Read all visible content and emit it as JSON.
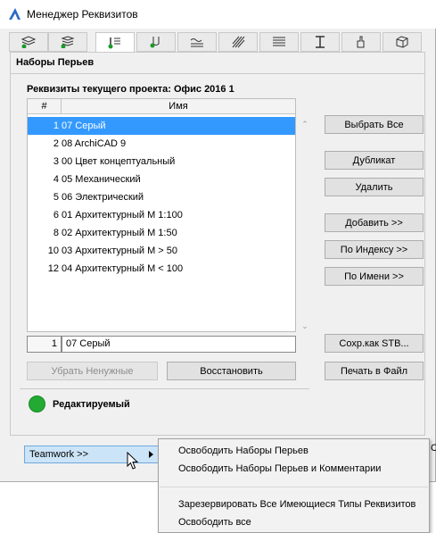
{
  "window": {
    "title": "Менеджер Реквизитов",
    "panel_title": "Наборы Перьев",
    "section_label": "Реквизиты текущего проекта: Офис 2016 1"
  },
  "tabs": [
    {
      "icon": "layers-icon",
      "active": false
    },
    {
      "icon": "layer-combinations-icon",
      "active": false
    },
    {
      "icon": "pen-sets-icon",
      "active": true
    },
    {
      "icon": "pen-icon",
      "active": false
    },
    {
      "icon": "line-types-icon",
      "active": false
    },
    {
      "icon": "fill-types-icon",
      "active": false
    },
    {
      "icon": "composites-icon",
      "active": false
    },
    {
      "icon": "profiles-icon",
      "active": false
    },
    {
      "icon": "surfaces-icon",
      "active": false
    },
    {
      "icon": "building-materials-icon",
      "active": false
    }
  ],
  "list": {
    "headers": {
      "num": "#",
      "name": "Имя"
    },
    "rows": [
      {
        "num": "1",
        "name": "07 Серый",
        "selected": true
      },
      {
        "num": "2",
        "name": "08 ArchiCAD 9",
        "selected": false
      },
      {
        "num": "3",
        "name": "00 Цвет концептуальный",
        "selected": false
      },
      {
        "num": "4",
        "name": "05 Механический",
        "selected": false
      },
      {
        "num": "5",
        "name": "06 Электрический",
        "selected": false
      },
      {
        "num": "6",
        "name": "01 Архитектурный М 1:100",
        "selected": false
      },
      {
        "num": "8",
        "name": "02 Архитектурный М 1:50",
        "selected": false
      },
      {
        "num": "10",
        "name": "03 Архитектурный М > 50",
        "selected": false
      },
      {
        "num": "12",
        "name": "04 Архитектурный М < 100",
        "selected": false
      }
    ],
    "current_index": "1",
    "current_name": "07 Серый"
  },
  "buttons": {
    "select_all": "Выбрать Все",
    "duplicate": "Дубликат",
    "delete": "Удалить",
    "add": "Добавить >>",
    "by_index": "По Индексу >>",
    "by_name": "По Имени >>",
    "save_as": "Сохр.как STB...",
    "print": "Печать в Файл",
    "remove_unused": "Убрать Ненужные",
    "restore": "Восстановить"
  },
  "status": {
    "label": "Редактируемый",
    "color": "#22aa33"
  },
  "teamwork": {
    "label": "Teamwork >>"
  },
  "menu": {
    "items": [
      "Освободить Наборы Перьев",
      "Освободить Наборы Перьев и Комментарии",
      "Зарезервировать Все Имеющиеся Типы Реквизитов",
      "Освободить все"
    ]
  },
  "edge_char": "С"
}
